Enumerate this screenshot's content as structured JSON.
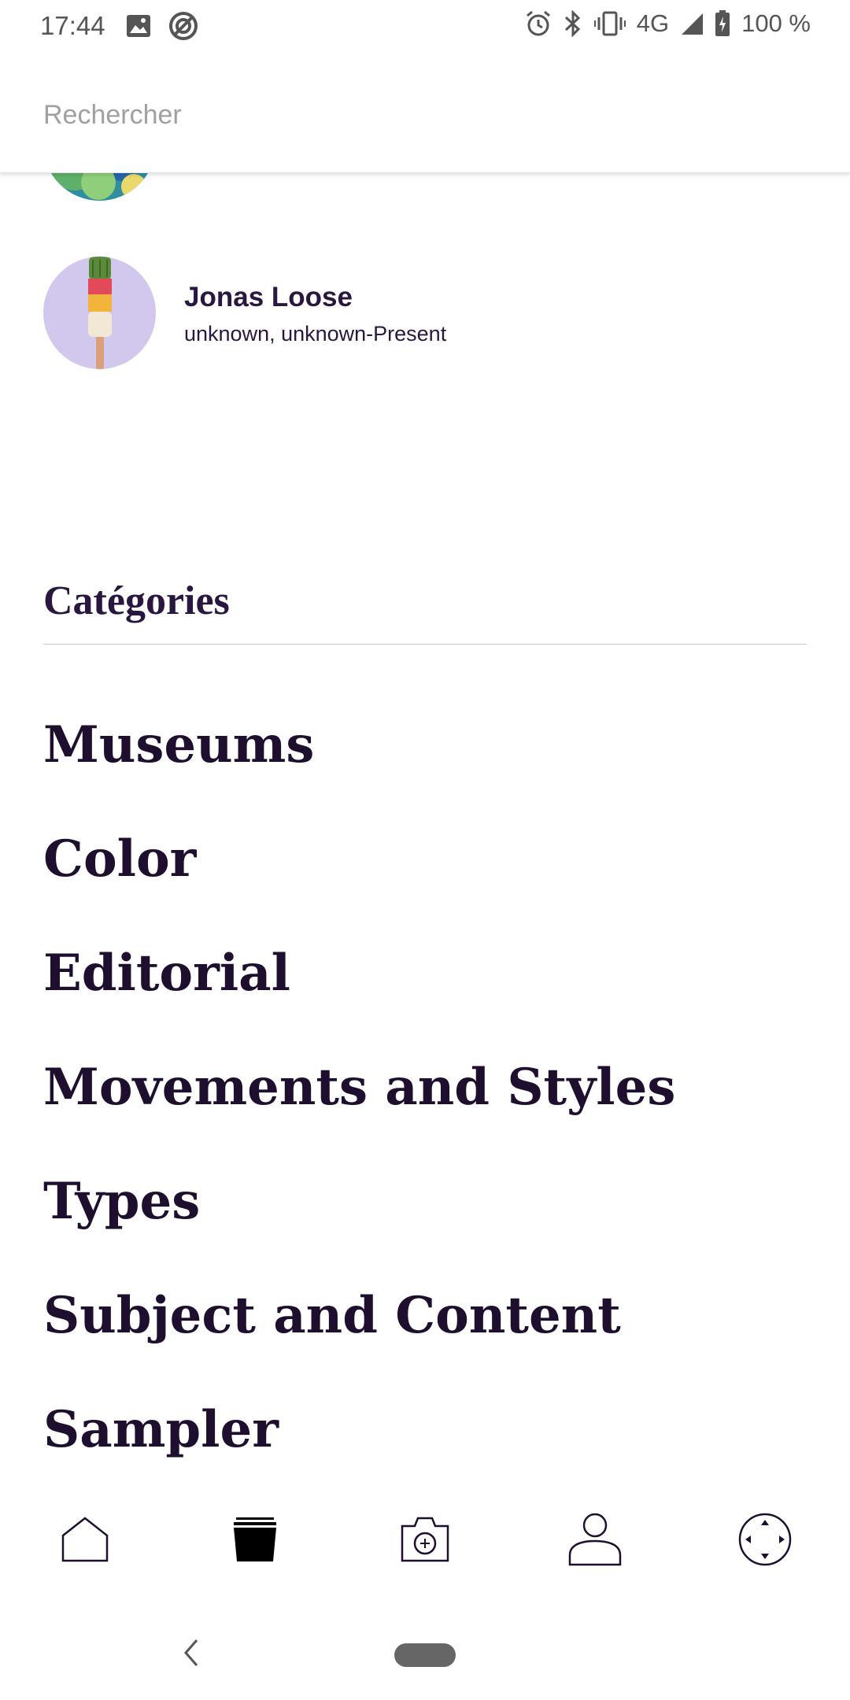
{
  "status_bar": {
    "time": "17:44",
    "network": "4G",
    "battery": "100 %",
    "icons_left": [
      "image-icon",
      "sync-icon"
    ],
    "icons_right": [
      "alarm-icon",
      "bluetooth-icon",
      "vibrate-icon",
      "signal-icon",
      "battery-icon"
    ]
  },
  "search": {
    "placeholder": "Rechercher",
    "value": ""
  },
  "artists": [
    {
      "name": "",
      "dates": ""
    },
    {
      "name": "Jonas Loose",
      "dates": "unknown, unknown-Present"
    }
  ],
  "categories": {
    "title": "Catégories",
    "items": [
      {
        "label": "Museums"
      },
      {
        "label": "Color"
      },
      {
        "label": "Editorial"
      },
      {
        "label": "Movements and Styles"
      },
      {
        "label": "Types"
      },
      {
        "label": "Subject and Content"
      },
      {
        "label": "Sampler"
      }
    ]
  },
  "bottom_nav": {
    "items": [
      "home-icon",
      "collections-icon",
      "camera-icon",
      "profile-icon",
      "explore-icon"
    ],
    "active": "collections-icon"
  },
  "colors": {
    "primary_text": "#1e0f2e",
    "accent": "#2a1740",
    "divider": "#cfc8dc",
    "avatar_lavender": "#d2c8ee"
  }
}
